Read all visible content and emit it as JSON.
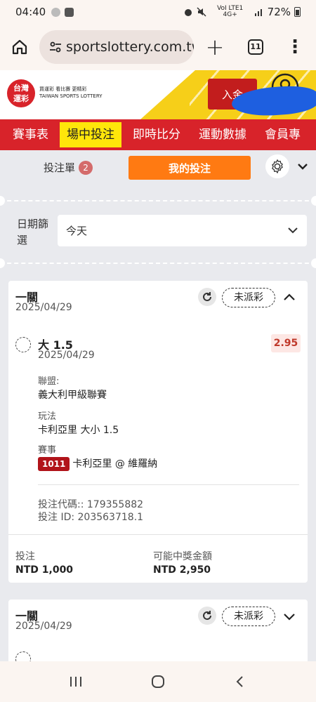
{
  "status_bar": {
    "time": "04:40",
    "network": "VoI LTE1 4G+",
    "battery": "72%"
  },
  "browser": {
    "url": "sportslottery.com.tw",
    "tab_count": "11"
  },
  "site": {
    "logo_text": "台灣\n運彩",
    "brand_line1": "買運彩 看比賽 更精彩",
    "brand_line2": "TAIWAN SPORTS LOTTERY",
    "deposit_label": "入金"
  },
  "nav": {
    "items": [
      "賽事表",
      "場中投注",
      "即時比分",
      "運動數據",
      "會員專"
    ],
    "active_index": 1
  },
  "bet_panel": {
    "slip_label": "投注單",
    "slip_count": "2",
    "my_bets_label": "我的投注",
    "date_filter_label": "日期篩選",
    "date_filter_value": "今天"
  },
  "bets": [
    {
      "type": "一關",
      "date": "2025/04/29",
      "status": "未派彩",
      "selection": "大 1.5",
      "selection_date": "2025/04/29",
      "odds": "2.95",
      "league_label": "聯盟:",
      "league": "義大利甲級聯賽",
      "market_label": "玩法",
      "market": "卡利亞里 大小 1.5",
      "event_label": "賽事",
      "event_number": "1011",
      "event": "卡利亞里 @ 維羅納",
      "bet_code": "投注代碼:: 179355882",
      "bet_id": "投注 ID: 203563718.1",
      "stake_label": "投注",
      "stake": "NTD 1,000",
      "payout_label": "可能中獎金額",
      "payout": "NTD 2,950"
    },
    {
      "type": "一關",
      "date": "2025/04/29",
      "status": "未派彩"
    }
  ]
}
